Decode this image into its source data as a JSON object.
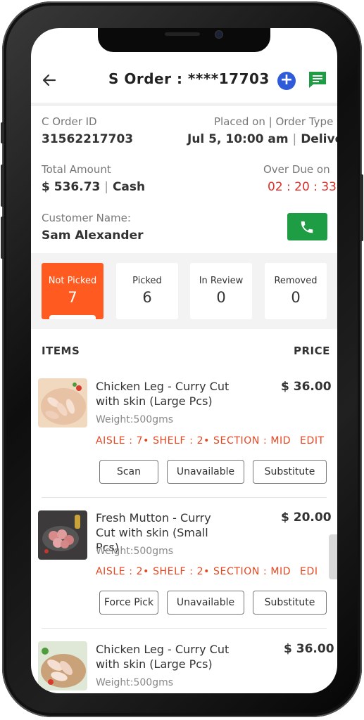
{
  "header": {
    "title": "S Order : ****17703",
    "plus_icon": "+"
  },
  "order": {
    "c_order_label": "C Order ID",
    "c_order_value": "31562217703",
    "placed_label": "Placed on | Order Type",
    "placed_date": "Jul 5, 10:00 am",
    "order_type": "Delivery",
    "total_label": "Total Amount",
    "total_value": "$ 536.73",
    "payment": "Cash",
    "overdue_label": "Over Due on",
    "overdue_value": "02 : 20 : 33",
    "customer_label": "Customer Name:",
    "customer_name": "Sam Alexander"
  },
  "status": [
    {
      "label": "Not Picked",
      "count": "7"
    },
    {
      "label": "Picked",
      "count": "6"
    },
    {
      "label": "In Review",
      "count": "0"
    },
    {
      "label": "Removed",
      "count": "0"
    }
  ],
  "list_header": {
    "items": "ITEMS",
    "price": "PRICE"
  },
  "items": [
    {
      "name": "Chicken Leg - Curry Cut with skin (Large Pcs)",
      "price": "$ 36.00",
      "weight": "Weight:500gms",
      "location": "AISLE : 7• SHELF : 2• SECTION : MID",
      "edit": "EDIT",
      "buttons": [
        "Scan",
        "Unavailable",
        "Substitute"
      ]
    },
    {
      "name": "Fresh Mutton - Curry Cut with skin (Small Pcs)",
      "price": "$ 20.00",
      "weight": "Weight:500gms",
      "location": "AISLE : 2• SHELF : 2• SECTION : MID",
      "edit": "EDI",
      "buttons": [
        "Force Pick",
        "Unavailable",
        "Substitute"
      ]
    },
    {
      "name": "Chicken Leg - Curry Cut with skin (Large Pcs)",
      "price": "$ 36.00",
      "weight": "Weight:500gms"
    }
  ],
  "colors": {
    "accent_orange": "#ff5a1f",
    "alert_red": "#e0302a",
    "call_green": "#1f9d44",
    "plus_blue": "#2f5bd8",
    "msg_green": "#1f9d44"
  },
  "icons": {
    "back": "arrow-left-icon",
    "add": "plus-circle-icon",
    "message": "message-icon",
    "call": "phone-icon"
  }
}
